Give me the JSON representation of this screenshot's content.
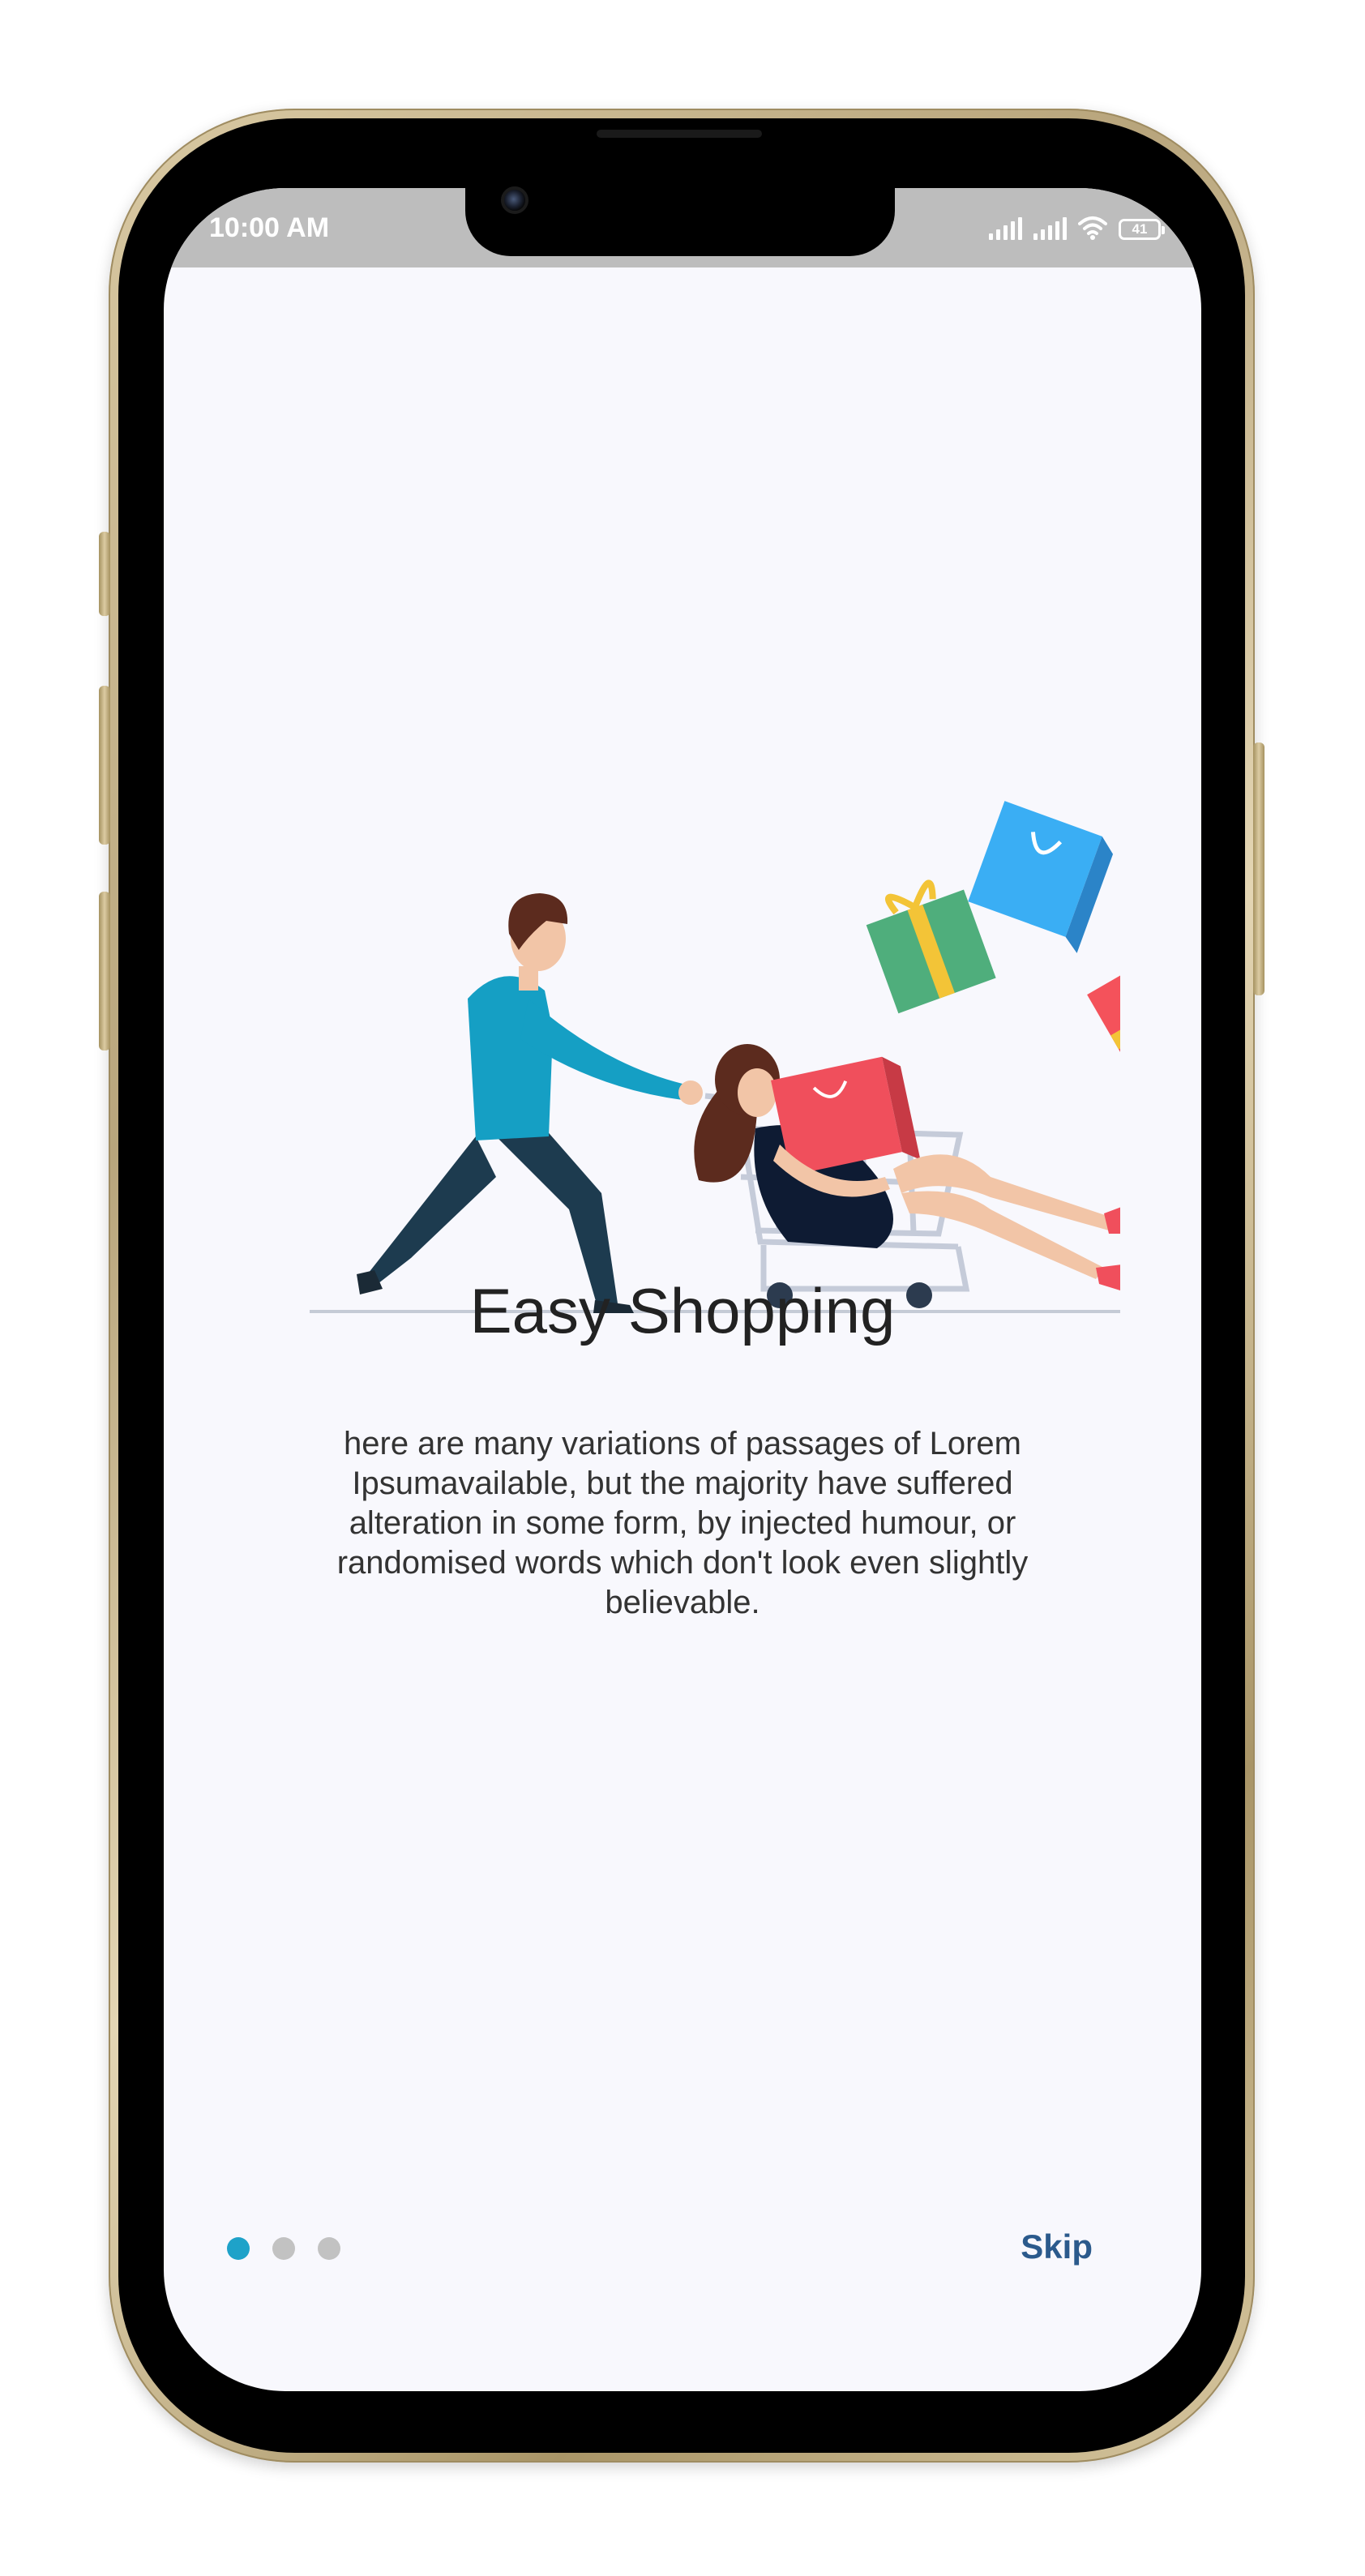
{
  "status_bar": {
    "time": "10:00 AM",
    "battery": "41"
  },
  "onboarding": {
    "title": "Easy Shopping",
    "description": "here are many variations of passages of Lorem Ipsumavailable, but the majority have suffered alteration in some form, by injected humour, or randomised words which don't look even slightly believable.",
    "skip_label": "Skip",
    "page_count": 3,
    "current_page": 1
  },
  "colors": {
    "accent_dot": "#1ea2c9",
    "inactive_dot": "#c2c2c2",
    "skip_text": "#2b5a8c",
    "screen_bg": "#f8f8fd",
    "status_bar_bg": "#bdbdbd"
  },
  "illustration": {
    "icon": "shopping-cart-illustration"
  }
}
